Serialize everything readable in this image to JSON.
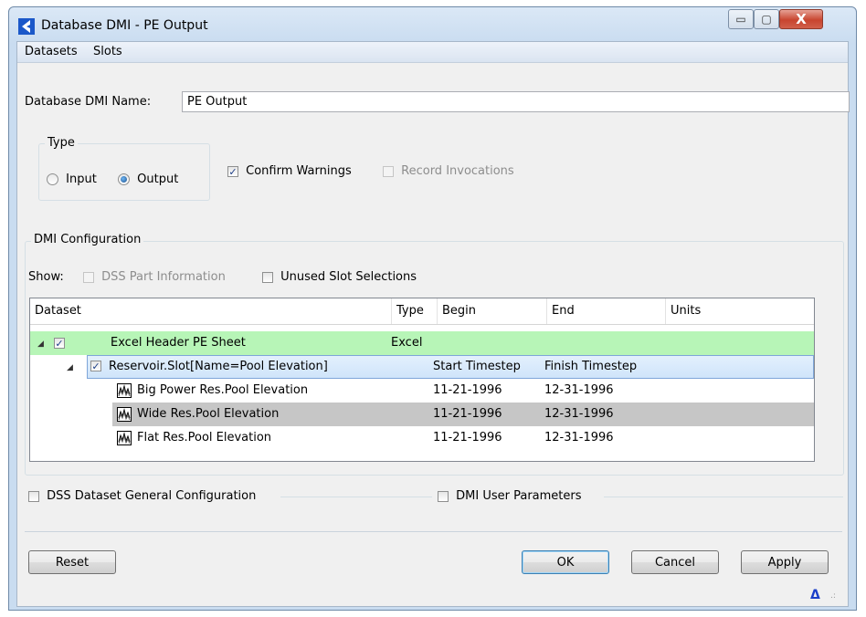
{
  "window": {
    "title": "Database DMI - PE Output",
    "min_glyph": "▭",
    "max_glyph": "▢",
    "close_glyph": "X"
  },
  "menu": [
    "Datasets",
    "Slots"
  ],
  "dmi_name": {
    "label": "Database DMI Name:",
    "value": "PE Output"
  },
  "type_group": {
    "label": "Type",
    "input_label": "Input",
    "output_label": "Output",
    "selected": "Output"
  },
  "options": {
    "confirm_warnings": "Confirm Warnings",
    "confirm_checked": true,
    "record_invocations": "Record Invocations",
    "record_enabled": false
  },
  "config": {
    "label": "DMI Configuration",
    "show_label": "Show:",
    "dss_part": "DSS Part Information",
    "unused_slots": "Unused Slot Selections"
  },
  "table": {
    "columns": [
      "Dataset",
      "Type",
      "Begin",
      "End",
      "Units"
    ],
    "rows": [
      {
        "name": "Excel Header PE Sheet",
        "type": "Excel",
        "begin": "",
        "end": "",
        "units": ""
      },
      {
        "name": "Reservoir.Slot[Name=Pool Elevation]",
        "type": "",
        "begin": "Start Timestep",
        "end": "Finish Timestep",
        "units": ""
      },
      {
        "name": "Big Power Res.Pool Elevation",
        "type": "",
        "begin": "11-21-1996",
        "end": "12-31-1996",
        "units": ""
      },
      {
        "name": "Wide Res.Pool Elevation",
        "type": "",
        "begin": "11-21-1996",
        "end": "12-31-1996",
        "units": ""
      },
      {
        "name": "Flat Res.Pool Elevation",
        "type": "",
        "begin": "11-21-1996",
        "end": "12-31-1996",
        "units": ""
      }
    ]
  },
  "bottom_options": {
    "dss_general": "DSS Dataset General Configuration",
    "dmi_user_params": "DMI User Parameters"
  },
  "buttons": {
    "reset": "Reset",
    "ok": "OK",
    "cancel": "Cancel",
    "apply": "Apply"
  },
  "colors": {
    "green_row": "#b7f5b7",
    "blue_row": "#cfe4fa",
    "selected_row": "#c6c6c6",
    "accent": "#1b58c9"
  },
  "icons": {
    "app": "riverware-logo-icon",
    "series": "timeseries-chart-icon",
    "corner": "delta-icon"
  }
}
